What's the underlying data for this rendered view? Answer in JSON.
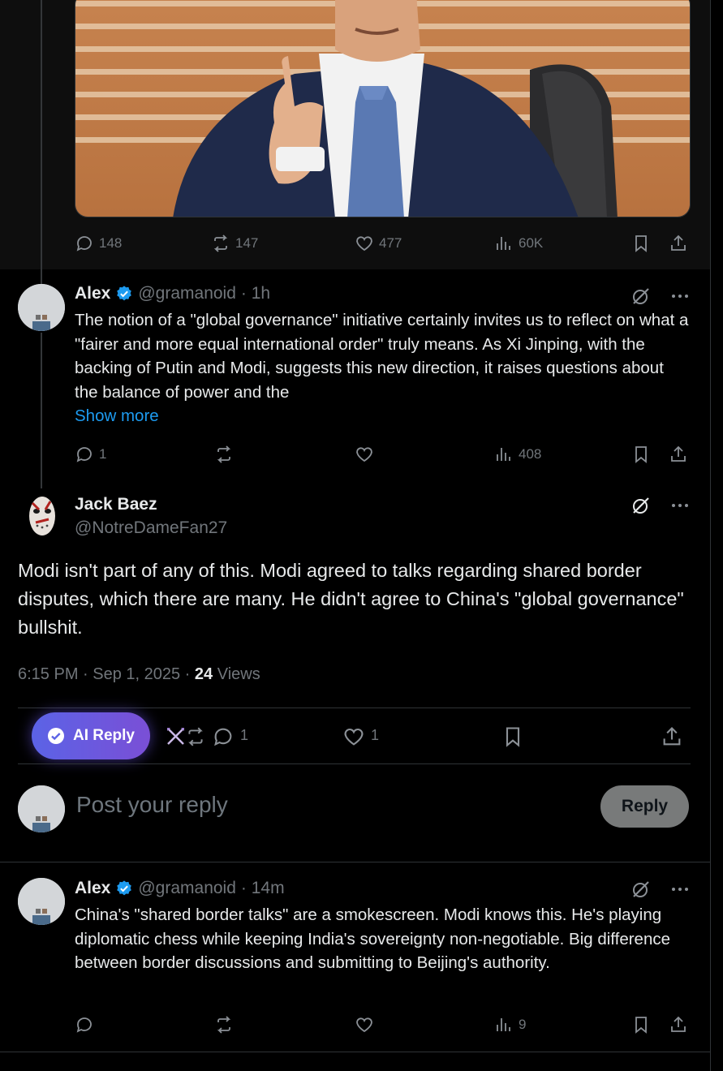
{
  "top_tweet": {
    "replies": "148",
    "reposts": "147",
    "likes": "477",
    "views": "60K"
  },
  "reply1": {
    "name": "Alex",
    "handle": "@gramanoid",
    "time": "· 1h",
    "text": "The notion of a \"global governance\" initiative certainly invites us to reflect on what a \"fairer and more equal international order\" truly means. As Xi Jinping, with the backing of Putin and Modi, suggests this new direction, it raises questions about the balance of power and the",
    "show_more": "Show more",
    "replies": "1",
    "views": "408"
  },
  "main_tweet": {
    "name": "Jack Baez",
    "handle": "@NotreDameFan27",
    "text": "Modi isn't part of any of this. Modi agreed to talks regarding shared border disputes, which there are many. He didn't agree to China's \"global governance\" bullshit.",
    "timestamp": "6:15 PM · Sep 1, 2025 · ",
    "views_count": "24",
    "views_label": " Views",
    "ai_reply_label": "AI Reply",
    "replies": "1",
    "likes": "1"
  },
  "composer": {
    "placeholder": "Post your reply",
    "reply_button": "Reply"
  },
  "reply2": {
    "name": "Alex",
    "handle": "@gramanoid",
    "time": "· 14m",
    "text": "China's \"shared border talks\" are a smokescreen. Modi knows this. He's playing diplomatic chess while keeping India's sovereignty non-negotiable. Big difference between border discussions and submitting to Beijing's authority.",
    "views": "9"
  },
  "colors": {
    "accent": "#1d9bf0",
    "muted": "#71767b",
    "text": "#e7e9ea",
    "ai_gradient_start": "#5b63e6",
    "ai_gradient_end": "#7a4fd6"
  }
}
